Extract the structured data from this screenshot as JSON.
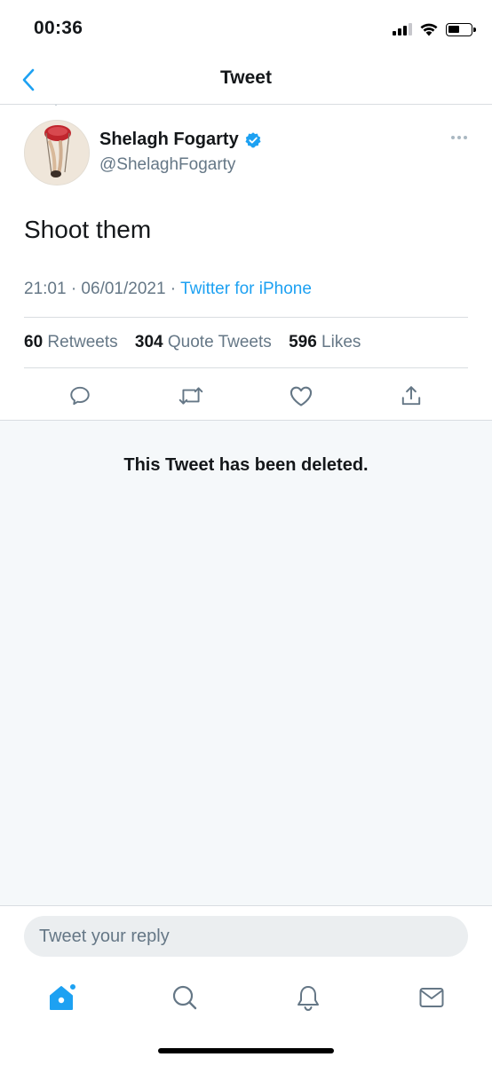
{
  "status_bar": {
    "time": "00:36"
  },
  "nav": {
    "title": "Tweet",
    "back_icon": "chevron-left-icon"
  },
  "tweet": {
    "author": {
      "name": "Shelagh Fogarty",
      "handle": "@ShelaghFogarty",
      "verified": true
    },
    "text": "Shoot them",
    "timestamp": "21:01 · 06/01/2021 · ",
    "source": "Twitter for iPhone",
    "stats": {
      "retweets_count": "60",
      "retweets_label": "Retweets",
      "quote_tweets_count": "304",
      "quote_tweets_label": "Quote Tweets",
      "likes_count": "596",
      "likes_label": "Likes"
    },
    "actions": [
      "reply-icon",
      "retweet-icon",
      "like-icon",
      "share-icon"
    ]
  },
  "deleted_notice": "This Tweet has been deleted.",
  "reply": {
    "placeholder": "Tweet your reply"
  },
  "tab_bar": {
    "items": [
      "home-icon",
      "search-icon",
      "notifications-icon",
      "messages-icon"
    ]
  },
  "colors": {
    "accent": "#1da1f2",
    "secondary_text": "#657786",
    "background_gray": "#f5f8fa",
    "border": "#d9dde1"
  }
}
